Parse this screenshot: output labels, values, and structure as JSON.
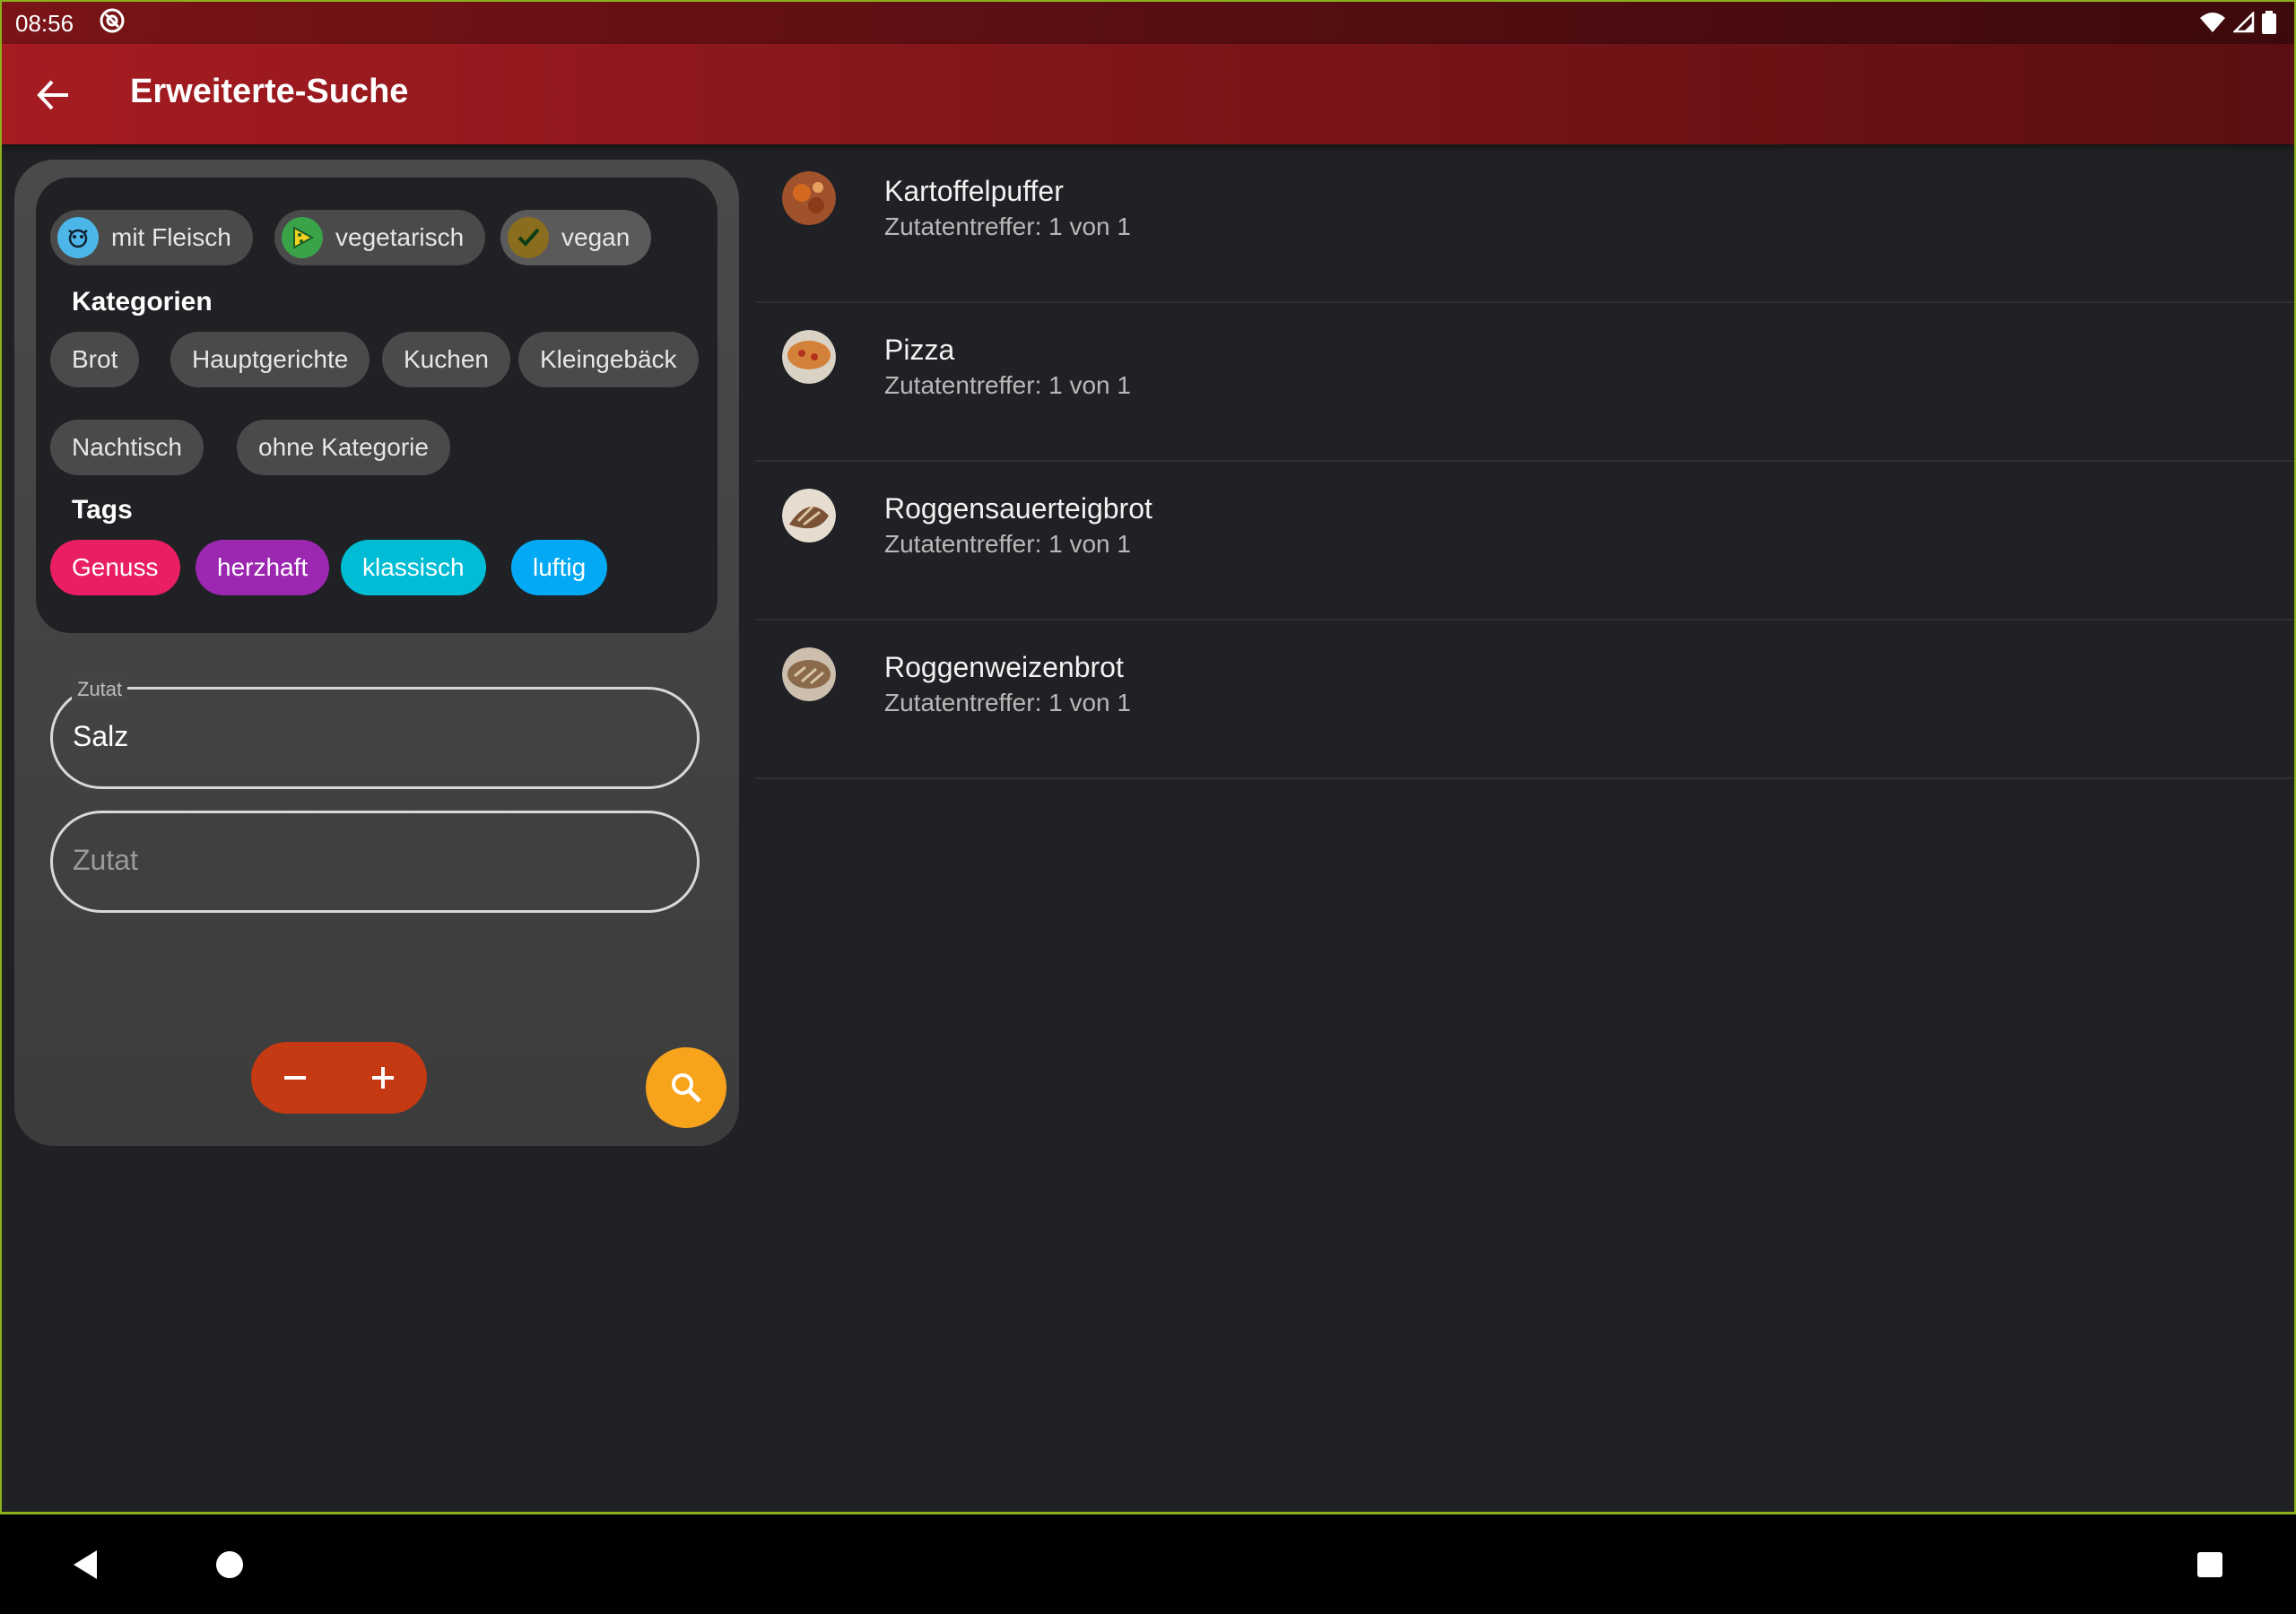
{
  "status_bar": {
    "time": "08:56"
  },
  "app_bar": {
    "title": "Erweiterte-Suche"
  },
  "filters": {
    "diet_chips": [
      {
        "label": "mit Fleisch",
        "icon": "cow-icon",
        "color": "#4db6e8"
      },
      {
        "label": "vegetarisch",
        "icon": "cheese-icon",
        "color": "#3aa34a"
      },
      {
        "label": "vegan",
        "icon": "check-leaf-icon",
        "color": "#8a6d1e"
      }
    ],
    "categories_title": "Kategorien",
    "categories": [
      "Brot",
      "Hauptgerichte",
      "Kuchen",
      "Kleingebäck",
      "Nachtisch",
      "ohne Kategorie"
    ],
    "tags_title": "Tags",
    "tags": [
      {
        "label": "Genuss",
        "color": "#e91e63"
      },
      {
        "label": "herzhaft",
        "color": "#9c27b0"
      },
      {
        "label": "klassisch",
        "color": "#00bcd4"
      },
      {
        "label": "luftig",
        "color": "#03a9f4"
      }
    ]
  },
  "ingredients": {
    "label": "Zutat",
    "field1_value": "Salz",
    "field2_placeholder": "Zutat"
  },
  "colors": {
    "accent_red": "#a51c21",
    "stepper": "#c53a12",
    "search_fab": "#f7a31c"
  },
  "results": [
    {
      "name": "Kartoffelpuffer",
      "match": "Zutatentreffer: 1 von 1"
    },
    {
      "name": "Pizza",
      "match": "Zutatentreffer: 1 von 1"
    },
    {
      "name": "Roggensauerteigbrot",
      "match": "Zutatentreffer: 1 von 1"
    },
    {
      "name": "Roggenweizenbrot",
      "match": "Zutatentreffer: 1 von 1"
    }
  ]
}
